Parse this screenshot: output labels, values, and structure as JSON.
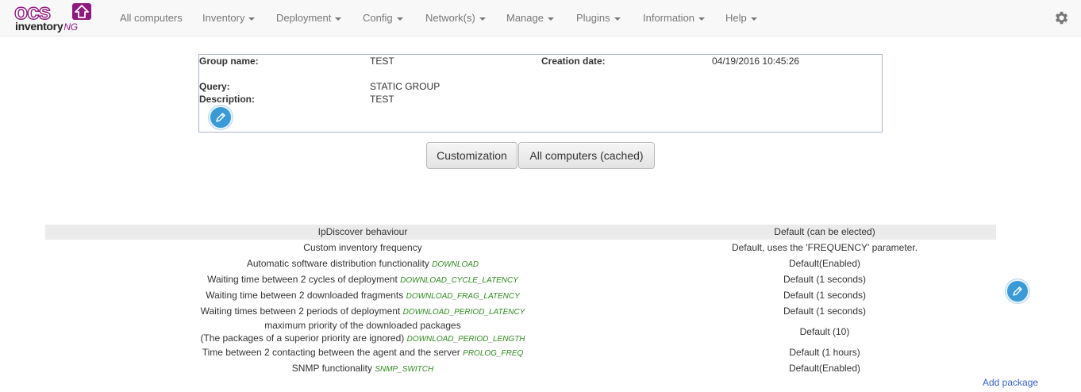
{
  "logo": {
    "top": "ocs",
    "bottom": "inventory",
    "suffix": "NG"
  },
  "nav": {
    "items": [
      {
        "label": "All computers"
      },
      {
        "label": "Inventory"
      },
      {
        "label": "Deployment"
      },
      {
        "label": "Config"
      },
      {
        "label": "Network(s)"
      },
      {
        "label": "Manage"
      },
      {
        "label": "Plugins"
      },
      {
        "label": "Information"
      },
      {
        "label": "Help"
      }
    ],
    "settings_icon": "gear-icon"
  },
  "group": {
    "name_label": "Group name:",
    "name_value": "TEST",
    "creation_label": "Creation date:",
    "creation_value": "04/19/2016 10:45:26",
    "query_label": "Query:",
    "query_value": "STATIC GROUP",
    "description_label": "Description:",
    "description_value": "TEST",
    "edit_icon": "pencil-icon"
  },
  "buttons": {
    "customization": "Customization",
    "all_computers_cached": "All computers (cached)"
  },
  "config": {
    "header": {
      "option": "IpDiscover behaviour",
      "value": "Default (can be elected)"
    },
    "rows": [
      {
        "label": "Custom inventory frequency",
        "code": "",
        "value": "Default, uses the 'FREQUENCY' parameter."
      },
      {
        "label": "Automatic software distribution functionality",
        "code": "DOWNLOAD",
        "value": "Default(Enabled)"
      },
      {
        "label": "Waiting time between 2 cycles of deployment",
        "code": "DOWNLOAD_CYCLE_LATENCY",
        "value": "Default (1 seconds)"
      },
      {
        "label": "Waiting time between 2 downloaded fragments",
        "code": "DOWNLOAD_FRAG_LATENCY",
        "value": "Default (1 seconds)"
      },
      {
        "label": "Waiting times between 2 periods of deployment",
        "code": "DOWNLOAD_PERIOD_LATENCY",
        "value": "Default (1 seconds)"
      },
      {
        "label": "maximum priority of the downloaded packages",
        "label2": "(The packages of a superior priority are ignored)",
        "code": "DOWNLOAD_PERIOD_LENGTH",
        "value": "Default (10)"
      },
      {
        "label": "Time between 2 contacting between the agent and the server",
        "code": "PROLOG_FREQ",
        "value": "Default (1 hours)"
      },
      {
        "label": "SNMP functionality",
        "code": "SNMP_SWITCH",
        "value": "Default(Enabled)"
      }
    ],
    "edit_icon": "pencil-icon",
    "add_package": "Add package"
  },
  "colors": {
    "brand": "#8f1a7e",
    "edit_button": "#3a9ad6",
    "option_code": "#2e8b1e",
    "link": "#3660c8",
    "header_bg": "#ebebeb"
  }
}
